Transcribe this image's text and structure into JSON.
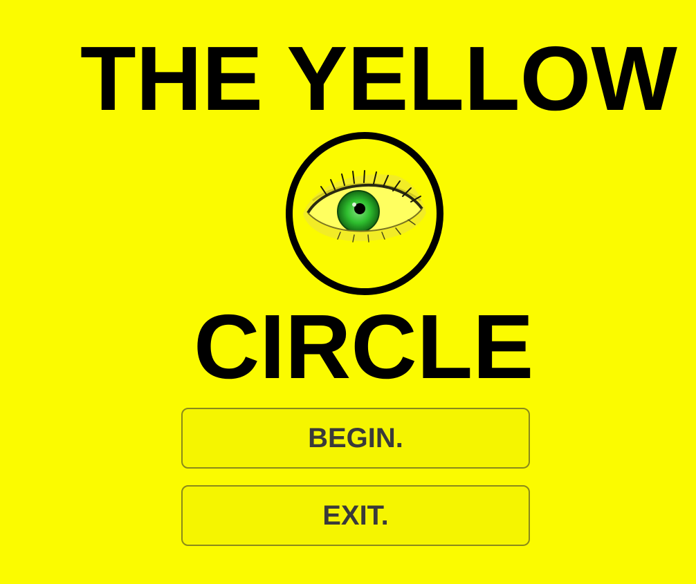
{
  "title": {
    "line1": "THE YELLOW",
    "line2": "CIRCLE"
  },
  "logo": {
    "icon": "eye-in-circle-icon",
    "ring_color": "#000000",
    "iris_color": "#2fbf2f"
  },
  "menu": {
    "begin_label": "BEGIN.",
    "exit_label": "EXIT."
  },
  "colors": {
    "background": "#fbfb00",
    "button_fill": "#f5f500",
    "button_border": "#8a8a1a",
    "button_text": "#3a3a3a",
    "title_text": "#000000"
  }
}
